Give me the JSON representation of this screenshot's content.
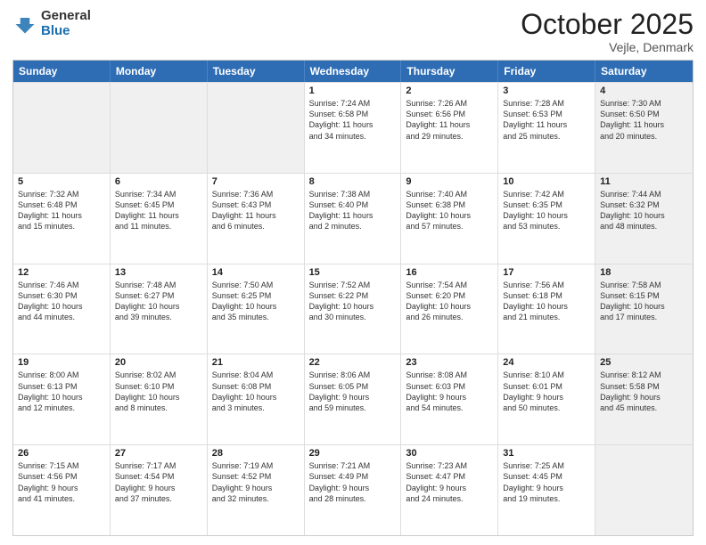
{
  "header": {
    "logo_general": "General",
    "logo_blue": "Blue",
    "month_title": "October 2025",
    "location": "Vejle, Denmark"
  },
  "days_of_week": [
    "Sunday",
    "Monday",
    "Tuesday",
    "Wednesday",
    "Thursday",
    "Friday",
    "Saturday"
  ],
  "rows": [
    [
      {
        "day": "",
        "info": "",
        "shaded": true
      },
      {
        "day": "",
        "info": "",
        "shaded": true
      },
      {
        "day": "",
        "info": "",
        "shaded": true
      },
      {
        "day": "1",
        "info": "Sunrise: 7:24 AM\nSunset: 6:58 PM\nDaylight: 11 hours\nand 34 minutes."
      },
      {
        "day": "2",
        "info": "Sunrise: 7:26 AM\nSunset: 6:56 PM\nDaylight: 11 hours\nand 29 minutes."
      },
      {
        "day": "3",
        "info": "Sunrise: 7:28 AM\nSunset: 6:53 PM\nDaylight: 11 hours\nand 25 minutes."
      },
      {
        "day": "4",
        "info": "Sunrise: 7:30 AM\nSunset: 6:50 PM\nDaylight: 11 hours\nand 20 minutes.",
        "shaded": true
      }
    ],
    [
      {
        "day": "5",
        "info": "Sunrise: 7:32 AM\nSunset: 6:48 PM\nDaylight: 11 hours\nand 15 minutes."
      },
      {
        "day": "6",
        "info": "Sunrise: 7:34 AM\nSunset: 6:45 PM\nDaylight: 11 hours\nand 11 minutes."
      },
      {
        "day": "7",
        "info": "Sunrise: 7:36 AM\nSunset: 6:43 PM\nDaylight: 11 hours\nand 6 minutes."
      },
      {
        "day": "8",
        "info": "Sunrise: 7:38 AM\nSunset: 6:40 PM\nDaylight: 11 hours\nand 2 minutes."
      },
      {
        "day": "9",
        "info": "Sunrise: 7:40 AM\nSunset: 6:38 PM\nDaylight: 10 hours\nand 57 minutes."
      },
      {
        "day": "10",
        "info": "Sunrise: 7:42 AM\nSunset: 6:35 PM\nDaylight: 10 hours\nand 53 minutes."
      },
      {
        "day": "11",
        "info": "Sunrise: 7:44 AM\nSunset: 6:32 PM\nDaylight: 10 hours\nand 48 minutes.",
        "shaded": true
      }
    ],
    [
      {
        "day": "12",
        "info": "Sunrise: 7:46 AM\nSunset: 6:30 PM\nDaylight: 10 hours\nand 44 minutes."
      },
      {
        "day": "13",
        "info": "Sunrise: 7:48 AM\nSunset: 6:27 PM\nDaylight: 10 hours\nand 39 minutes."
      },
      {
        "day": "14",
        "info": "Sunrise: 7:50 AM\nSunset: 6:25 PM\nDaylight: 10 hours\nand 35 minutes."
      },
      {
        "day": "15",
        "info": "Sunrise: 7:52 AM\nSunset: 6:22 PM\nDaylight: 10 hours\nand 30 minutes."
      },
      {
        "day": "16",
        "info": "Sunrise: 7:54 AM\nSunset: 6:20 PM\nDaylight: 10 hours\nand 26 minutes."
      },
      {
        "day": "17",
        "info": "Sunrise: 7:56 AM\nSunset: 6:18 PM\nDaylight: 10 hours\nand 21 minutes."
      },
      {
        "day": "18",
        "info": "Sunrise: 7:58 AM\nSunset: 6:15 PM\nDaylight: 10 hours\nand 17 minutes.",
        "shaded": true
      }
    ],
    [
      {
        "day": "19",
        "info": "Sunrise: 8:00 AM\nSunset: 6:13 PM\nDaylight: 10 hours\nand 12 minutes."
      },
      {
        "day": "20",
        "info": "Sunrise: 8:02 AM\nSunset: 6:10 PM\nDaylight: 10 hours\nand 8 minutes."
      },
      {
        "day": "21",
        "info": "Sunrise: 8:04 AM\nSunset: 6:08 PM\nDaylight: 10 hours\nand 3 minutes."
      },
      {
        "day": "22",
        "info": "Sunrise: 8:06 AM\nSunset: 6:05 PM\nDaylight: 9 hours\nand 59 minutes."
      },
      {
        "day": "23",
        "info": "Sunrise: 8:08 AM\nSunset: 6:03 PM\nDaylight: 9 hours\nand 54 minutes."
      },
      {
        "day": "24",
        "info": "Sunrise: 8:10 AM\nSunset: 6:01 PM\nDaylight: 9 hours\nand 50 minutes."
      },
      {
        "day": "25",
        "info": "Sunrise: 8:12 AM\nSunset: 5:58 PM\nDaylight: 9 hours\nand 45 minutes.",
        "shaded": true
      }
    ],
    [
      {
        "day": "26",
        "info": "Sunrise: 7:15 AM\nSunset: 4:56 PM\nDaylight: 9 hours\nand 41 minutes."
      },
      {
        "day": "27",
        "info": "Sunrise: 7:17 AM\nSunset: 4:54 PM\nDaylight: 9 hours\nand 37 minutes."
      },
      {
        "day": "28",
        "info": "Sunrise: 7:19 AM\nSunset: 4:52 PM\nDaylight: 9 hours\nand 32 minutes."
      },
      {
        "day": "29",
        "info": "Sunrise: 7:21 AM\nSunset: 4:49 PM\nDaylight: 9 hours\nand 28 minutes."
      },
      {
        "day": "30",
        "info": "Sunrise: 7:23 AM\nSunset: 4:47 PM\nDaylight: 9 hours\nand 24 minutes."
      },
      {
        "day": "31",
        "info": "Sunrise: 7:25 AM\nSunset: 4:45 PM\nDaylight: 9 hours\nand 19 minutes."
      },
      {
        "day": "",
        "info": "",
        "shaded": true
      }
    ]
  ]
}
